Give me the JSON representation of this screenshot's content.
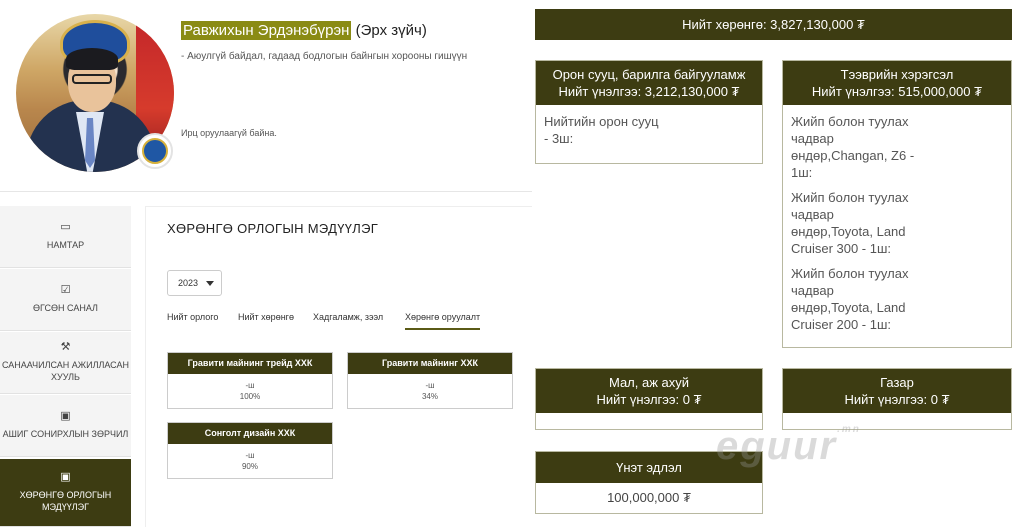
{
  "profile": {
    "name": "Равжихын Эрдэнэбүрэн",
    "title_suffix": "(Эрх зүйч)",
    "role": "- Аюулгүй байдал, гадаад бодлогын байнгын хорооны гишүүн",
    "attendance_note": "Ирц оруулаагүй байна."
  },
  "sidebar": {
    "items": [
      {
        "icon": "id-card-icon",
        "glyph": "▭",
        "label": "НАМТАР"
      },
      {
        "icon": "checkbox-icon",
        "glyph": "☑",
        "label": "ӨГСӨН САНАЛ"
      },
      {
        "icon": "gavel-icon",
        "glyph": "⚒",
        "label": "САНААЧИЛСАН АЖИЛЛАСАН\nХУУЛЬ"
      },
      {
        "icon": "money-icon",
        "glyph": "▣",
        "label": "АШИГ СОНИРХЛЫН ЗӨРЧИЛ"
      },
      {
        "icon": "money-icon",
        "glyph": "▣",
        "label": "ХӨРӨНГӨ ОРЛОГЫН\nМЭДҮҮЛЭГ"
      }
    ]
  },
  "main": {
    "section_title": "ХӨРӨНГӨ ОРЛОГЫН МЭДҮҮЛЭГ",
    "year": "2023",
    "tabs": [
      "Нийт орлого",
      "Нийт хөрөнгө",
      "Хадгаламж, зээл",
      "Хөрөнгө оруулалт"
    ],
    "companies": [
      {
        "name": "Гравити майнинг трейд ХХК",
        "units": "-ш",
        "percent": "100%"
      },
      {
        "name": "Гравити майнинг ХХК",
        "units": "-ш",
        "percent": "34%"
      },
      {
        "name": "Сонголт дизайн ХХК",
        "units": "-ш",
        "percent": "90%"
      }
    ]
  },
  "assets": {
    "total": "Нийт хөрөнгө: 3,827,130,000 ₮",
    "housing": {
      "title": "Орон сууц, барилга байгууламж",
      "value": "Нийт үнэлгээ: 3,212,130,000 ₮",
      "items": [
        "Нийтийн орон сууц",
        "- 3ш:"
      ]
    },
    "vehicles": {
      "title": "Тээврийн хэрэгсэл",
      "value": "Нийт үнэлгээ: 515,000,000 ₮",
      "items": [
        [
          "Жийп болон туулах",
          "чадвар",
          "өндөр,Changan, Z6 -",
          "1ш:"
        ],
        [
          "Жийп болон туулах",
          "чадвар",
          "өндөр,Toyota, Land",
          "Cruiser 300 - 1ш:"
        ],
        [
          "Жийп болон туулах",
          "чадвар",
          "өндөр,Toyota, Land",
          "Cruiser 200 - 1ш:"
        ]
      ]
    },
    "livestock": {
      "title": "Мал, аж ахуй",
      "value": "Нийт үнэлгээ: 0 ₮"
    },
    "land": {
      "title": "Газар",
      "value": "Нийт үнэлгээ: 0 ₮"
    },
    "securities": {
      "title": "Үнэт эдлэл",
      "value": "100,000,000 ₮"
    }
  },
  "watermark": {
    "text": "eguur",
    "suffix": ".mn"
  },
  "colors": {
    "accent": "#3d3c12",
    "highlight": "#8a8b14",
    "sidebar_bg": "#f4f4f4"
  }
}
